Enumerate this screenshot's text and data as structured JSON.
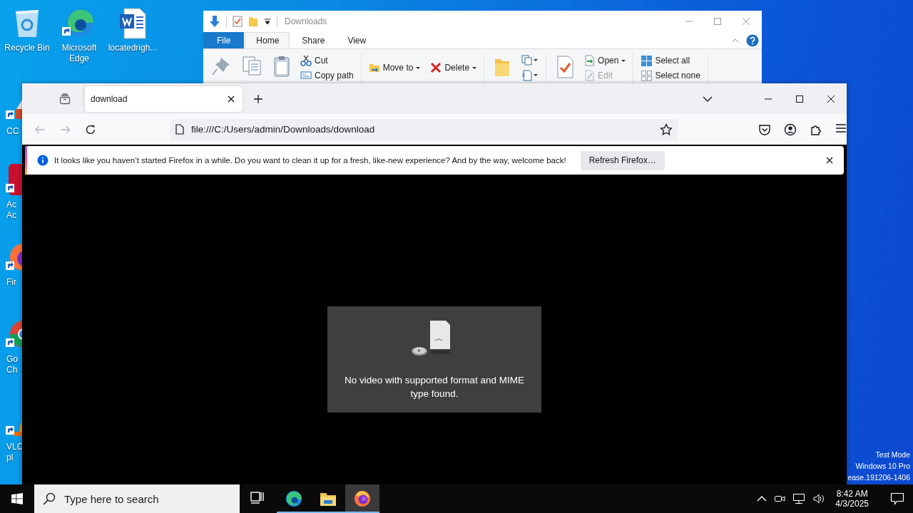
{
  "desktop_icons": [
    {
      "kind": "recycle-bin",
      "lines": [
        "Recycle Bin"
      ]
    },
    {
      "kind": "edge",
      "lines": [
        "Microsoft",
        "Edge"
      ]
    },
    {
      "kind": "word",
      "lines": [
        "locatedrigh..."
      ]
    },
    {
      "kind": "ccleaner",
      "lines": [
        "CC"
      ]
    },
    {
      "kind": "acrobat",
      "lines": [
        "Ac",
        "Ac"
      ]
    },
    {
      "kind": "firefox",
      "lines": [
        "Fir"
      ]
    },
    {
      "kind": "chrome",
      "lines": [
        "Go",
        "Ch"
      ]
    },
    {
      "kind": "vlc",
      "lines": [
        "VLC",
        "pl"
      ]
    }
  ],
  "explorer": {
    "title": "Downloads",
    "tabs": [
      {
        "label": "File",
        "kind": "file",
        "selected": false
      },
      {
        "label": "Home",
        "kind": "tab",
        "selected": true
      },
      {
        "label": "Share",
        "kind": "tab",
        "selected": false
      },
      {
        "label": "View",
        "kind": "tab",
        "selected": false
      }
    ],
    "ribbon_groups": [
      {
        "kind": "stack",
        "items": [
          {
            "kind": "pin"
          },
          {
            "kind": "copy"
          },
          {
            "kind": "paste"
          },
          {
            "kind": "cut",
            "label": "Cut"
          },
          {
            "kind": "copy-path",
            "label": "Copy path"
          }
        ]
      },
      {
        "kind": "row",
        "items": [
          {
            "kind": "move",
            "label": "Move to",
            "dropdown": true
          },
          {
            "kind": "delete",
            "label": "Delete",
            "dropdown": true
          }
        ]
      },
      {
        "kind": "stack",
        "items": [
          {
            "kind": "new-folder"
          },
          {
            "kind": "new-item",
            "dropdown": true
          },
          {
            "kind": "easy-access",
            "dropdown": true
          }
        ]
      },
      {
        "kind": "stack",
        "items": [
          {
            "kind": "properties"
          },
          {
            "kind": "open",
            "label": "Open",
            "dropdown": true
          },
          {
            "kind": "edit",
            "label": "Edit",
            "disabled": true
          }
        ]
      },
      {
        "kind": "stack",
        "items": [
          {
            "kind": "select-all",
            "label": "Select all"
          },
          {
            "kind": "select-none",
            "label": "Select none"
          }
        ]
      }
    ]
  },
  "browser": {
    "tab": {
      "title": "download",
      "selected": true
    },
    "back": {
      "disabled": true
    },
    "forward": {
      "disabled": true
    },
    "url": "file:///C:/Users/admin/Downloads/download",
    "notification": {
      "message": "It looks like you haven’t started Firefox in a while. Do you want to clean it up for a fresh, like-new experience? And by the way, welcome back!",
      "button": "Refresh Firefox…"
    },
    "video_error": "No video with supported format and MIME type found."
  },
  "os_notice": [
    "Test Mode",
    "Windows 10 Pro",
    "ease.191206-1406"
  ],
  "taskbar": {
    "search_placeholder": "Type here to search",
    "apps": [
      {
        "kind": "task-view",
        "running": false,
        "selected": false
      },
      {
        "kind": "edge",
        "running": true,
        "selected": false
      },
      {
        "kind": "explorer",
        "running": true,
        "selected": false
      },
      {
        "kind": "firefox",
        "running": true,
        "selected": true
      }
    ],
    "time": "8:42 AM",
    "date": "4/3/2025"
  }
}
